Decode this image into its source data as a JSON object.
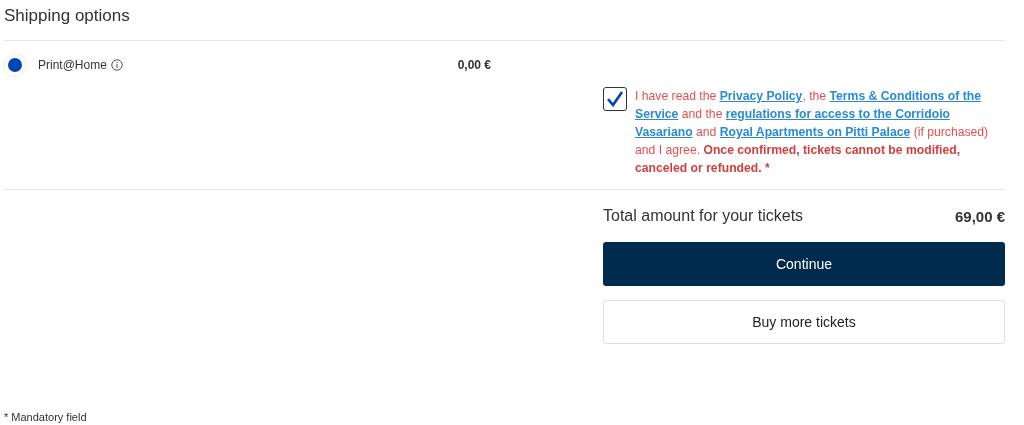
{
  "section_title": "Shipping options",
  "shipping_options": [
    {
      "label": "Print@Home",
      "price": "0,00 €",
      "selected": true
    }
  ],
  "agreement": {
    "checked": true,
    "parts": [
      {
        "kind": "text",
        "text": "I have read the "
      },
      {
        "kind": "link",
        "text": "Privacy Policy"
      },
      {
        "kind": "text",
        "text": ", the "
      },
      {
        "kind": "link",
        "text": "Terms & Conditions of the"
      },
      {
        "kind": "gap"
      },
      {
        "kind": "link",
        "text": "Service"
      },
      {
        "kind": "text",
        "text": " and the "
      },
      {
        "kind": "link",
        "text": "regulations for access to the Corridoio"
      },
      {
        "kind": "gap"
      },
      {
        "kind": "link",
        "text": "Vasariano"
      },
      {
        "kind": "text",
        "text": " and "
      },
      {
        "kind": "link",
        "text": "Royal Apartments on Pitti Palace"
      },
      {
        "kind": "text",
        "text": " (if purchased) and I agree. "
      },
      {
        "kind": "bold",
        "text": "Once confirmed, tickets cannot be modified, canceled or refunded. *"
      }
    ]
  },
  "total": {
    "label": "Total amount for your tickets",
    "amount": "69,00 €"
  },
  "buttons": [
    {
      "kind": "primary",
      "label": "Continue"
    },
    {
      "kind": "secondary",
      "label": "Buy more tickets"
    }
  ],
  "footnote": "* Mandatory field"
}
